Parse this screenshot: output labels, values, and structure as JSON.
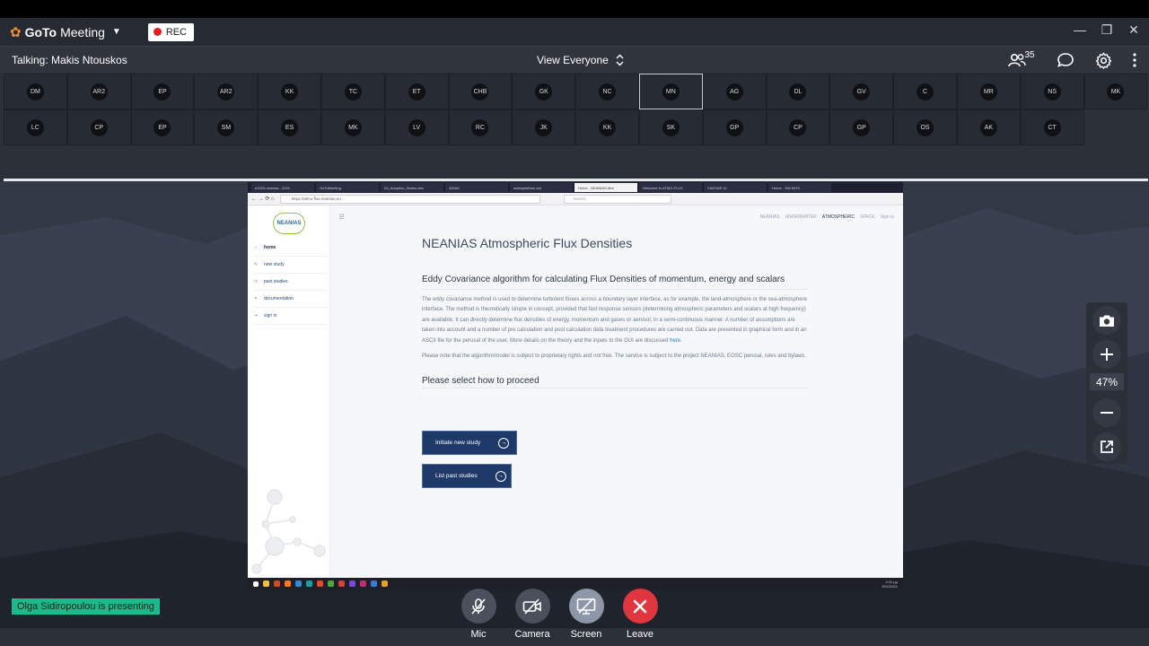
{
  "app": {
    "brand_bold": "GoTo",
    "brand_light": "Meeting",
    "rec_label": "REC",
    "window_controls": [
      "—",
      "❐",
      "✕"
    ]
  },
  "status": {
    "talking": "Talking: Makis Ntouskos",
    "view_label": "View Everyone",
    "participants_count": "35"
  },
  "participants": {
    "row1": [
      "DM",
      "AR2",
      "EP",
      "AR2",
      "KK",
      "TC",
      "ET",
      "CHB",
      "GK",
      "NC",
      "MN",
      "AG",
      "DL",
      "GV",
      "C",
      "MR",
      "NS",
      "MK"
    ],
    "row2": [
      "LC",
      "CP",
      "EP",
      "SM",
      "ES",
      "MK",
      "LV",
      "RC",
      "JK",
      "KK",
      "SK",
      "GP",
      "CP",
      "GP",
      "OS",
      "AK",
      "CT"
    ],
    "active": "MN"
  },
  "shared_screen": {
    "tabs": [
      "e2020-neanias - 2021",
      "GoToMeeting",
      "03_Adoption_Status.xlsx",
      "ADAM",
      "adamplatform.eu/",
      "Home - NEANIAS Atm",
      "Welcome to ATMO-FLUX",
      "CAESAR UI",
      "Home - SW-MOS"
    ],
    "url": "https://atmo-flux.neanias.eu",
    "search_placeholder": "Search",
    "site": {
      "brand": "NEANIAS",
      "menu": [
        "home",
        "new study",
        "past studies",
        "documentation",
        "sign in"
      ],
      "topnav": [
        "NEANIAS",
        "UNDERWATER",
        "ATMOSPHERIC",
        "SPACE",
        "Sign in"
      ],
      "page_title": "NEANIAS Atmospheric Flux Densities",
      "card_title": "Eddy Covariance algorithm for calculating Flux Densities of momentum, energy and scalars",
      "para1": "The eddy covariance method is used to determine turbulent fluxes across a boundary layer interface, as for example, the land-atmosphere or the sea-atmosphere interface. The method is theoretically simple in concept, provided that fast response sensors (determining atmospheric parameters and scalars at high frequency) are available. It can directly determine flux densities of energy, momentum and gases or aerosol, in a semi-continuous manner. A number of assumptions are taken into account and a number of pre calculation and post calculation data treatment procedures are carried out. Data are presented in graphical form and in an ASCII file for the perusal of the user. More details on the theory and the inputs to the GUI are discussed",
      "para1_link": "here",
      "para2": "Please note that the algorithm/model is subject to proprietary rights and not free. The service is subject to the project NEANIAS, EOSC perusal, rules and bylaws.",
      "proceed_title": "Please select how to proceed",
      "btn_initiate": "Initiate new study",
      "btn_list": "List past studies"
    },
    "clock_time": "4:31 μμ",
    "clock_date": "25/1/2021"
  },
  "zoom": {
    "level": "47%"
  },
  "presenter": "Olga Sidiropoulou is presenting",
  "controls": {
    "mic": "Mic",
    "camera": "Camera",
    "screen": "Screen",
    "leave": "Leave"
  }
}
